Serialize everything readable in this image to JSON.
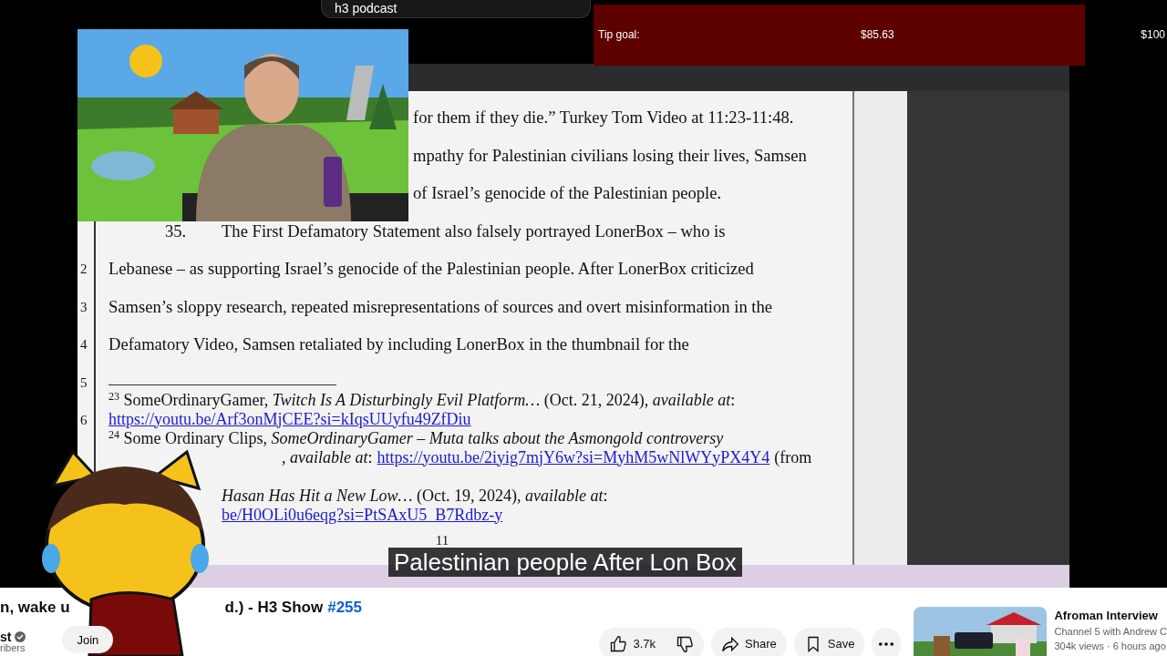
{
  "search": {
    "value": "h3 podcast"
  },
  "tip_goal": {
    "label": "Tip goal:",
    "amount": "$85.63",
    "target": "$100",
    "level": 0.8563
  },
  "document": {
    "body_lines": [
      {
        "kind": "cut",
        "text": "for them if they die.” Turkey Tom Video at 11:23-11:48."
      },
      {
        "kind": "cut",
        "text": "mpathy for Palestinian civilians losing their lives, Samsen"
      },
      {
        "kind": "cut",
        "text": "of Israel’s genocide of the Palestinian people."
      },
      {
        "kind": "numbered",
        "number": "35.",
        "text": "The First Defamatory Statement also falsely portrayed LonerBox – who is"
      },
      {
        "kind": "body",
        "text": "Lebanese – as supporting Israel’s genocide of the Palestinian people. After LonerBox criticized"
      },
      {
        "kind": "body",
        "text": "Samsen’s sloppy research, repeated misrepresentations of sources and overt misinformation in the"
      },
      {
        "kind": "body",
        "text": "Defamatory Video, Samsen retaliated by including LonerBox in the thumbnail for the"
      }
    ],
    "line_numbers": [
      "2",
      "3",
      "4",
      "5",
      "6"
    ],
    "footnote_lines": [
      {
        "kind": "full",
        "segments": [
          {
            "kind": "text",
            "text": "$^{23}$ SomeOrdinaryGamer, *Twitch Is A Disturbingly Evil Platform…* (Oct. 21, 2024), *available at*:"
          }
        ]
      },
      {
        "kind": "full",
        "segments": [
          {
            "kind": "link",
            "text": "https://youtu.be/Arf3onMjCEE?si=kIqsUUyfu49ZfDiu"
          }
        ]
      },
      {
        "kind": "full",
        "segments": [
          {
            "kind": "text",
            "text": "$^{24}$ Some Ordinary Clips, *SomeOrdinaryGamer – Muta talks about the Asmongold controversy*"
          }
        ]
      },
      {
        "kind": "cut_wide",
        "segments": [
          {
            "kind": "text",
            "text": ", *available at*:"
          },
          {
            "kind": "link",
            "text": "https://youtu.be/2iyig7mjY6w?si=MyhM5wNlWYyPX4Y4"
          },
          {
            "kind": "text",
            "text": "(from"
          }
        ]
      },
      {
        "kind": "blank"
      },
      {
        "kind": "cut",
        "segments": [
          {
            "kind": "text",
            "text": "*Hasan Has Hit a New Low…* (Oct. 19, 2024), *available at*:"
          }
        ]
      },
      {
        "kind": "cut",
        "segments": [
          {
            "kind": "link",
            "text": "be/H0OLi0u6eqg?si=PtSAxU5_B7Rdbz-y"
          }
        ]
      }
    ],
    "page_number": "11"
  },
  "caption": "Palestinian people After Lon Box",
  "video_info": {
    "title_start": "n, wake u",
    "title_end": "d.) - H3 Show",
    "hashtag": "#255",
    "channel": "st",
    "verified": true,
    "subscribers": "ribers",
    "join": "Join"
  },
  "actions": {
    "likes": "3.7k",
    "share": "Share",
    "save": "Save"
  },
  "recommended": {
    "title": "Afroman Interview",
    "channel": "Channel 5 with Andrew C",
    "meta": "304k views · 6 hours ago"
  }
}
